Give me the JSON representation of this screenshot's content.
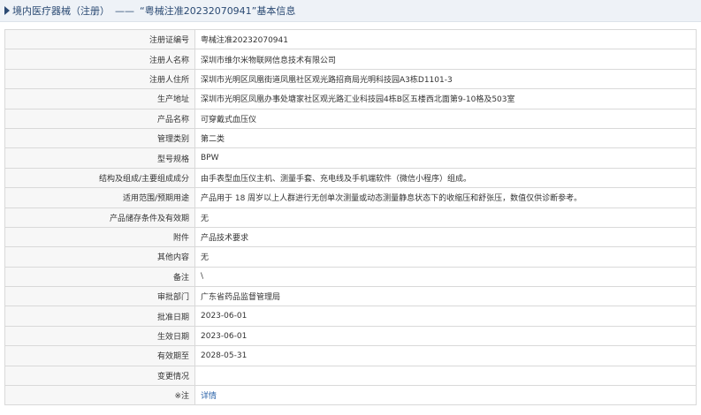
{
  "breadcrumb": {
    "section": "境内医疗器械（注册）",
    "separator": "——",
    "record_title": "“粤械注准20232070941”基本信息"
  },
  "rows": [
    {
      "label": "注册证编号",
      "value": "粤械注准20232070941"
    },
    {
      "label": "注册人名称",
      "value": "深圳市维尔米物联网信息技术有限公司"
    },
    {
      "label": "注册人住所",
      "value": "深圳市光明区凤凰街道凤凰社区观光路招商局光明科技园A3栋D1101-3"
    },
    {
      "label": "生产地址",
      "value": "深圳市光明区凤凰办事处塘家社区观光路汇业科技园4栋B区五楼西北面第9-10格及503室"
    },
    {
      "label": "产品名称",
      "value": "可穿戴式血压仪"
    },
    {
      "label": "管理类别",
      "value": "第二类"
    },
    {
      "label": "型号规格",
      "value": "BPW"
    },
    {
      "label": "结构及组成/主要组成成分",
      "value": "由手表型血压仪主机、测量手套、充电线及手机端软件（微信小程序）组成。"
    },
    {
      "label": "适用范围/预期用途",
      "value": "产品用于 18 周岁以上人群进行无创单次测量或动态测量静息状态下的收缩压和舒张压，数值仅供诊断参考。"
    },
    {
      "label": "产品储存条件及有效期",
      "value": "无"
    },
    {
      "label": "附件",
      "value": "产品技术要求"
    },
    {
      "label": "其他内容",
      "value": "无"
    },
    {
      "label": "备注",
      "value": "\\"
    },
    {
      "label": "审批部门",
      "value": "广东省药品监督管理局"
    },
    {
      "label": "批准日期",
      "value": "2023-06-01"
    },
    {
      "label": "生效日期",
      "value": "2023-06-01"
    },
    {
      "label": "有效期至",
      "value": "2028-05-31"
    },
    {
      "label": "变更情况",
      "value": ""
    }
  ],
  "footer": {
    "label": "※注",
    "link_text": "详情"
  }
}
